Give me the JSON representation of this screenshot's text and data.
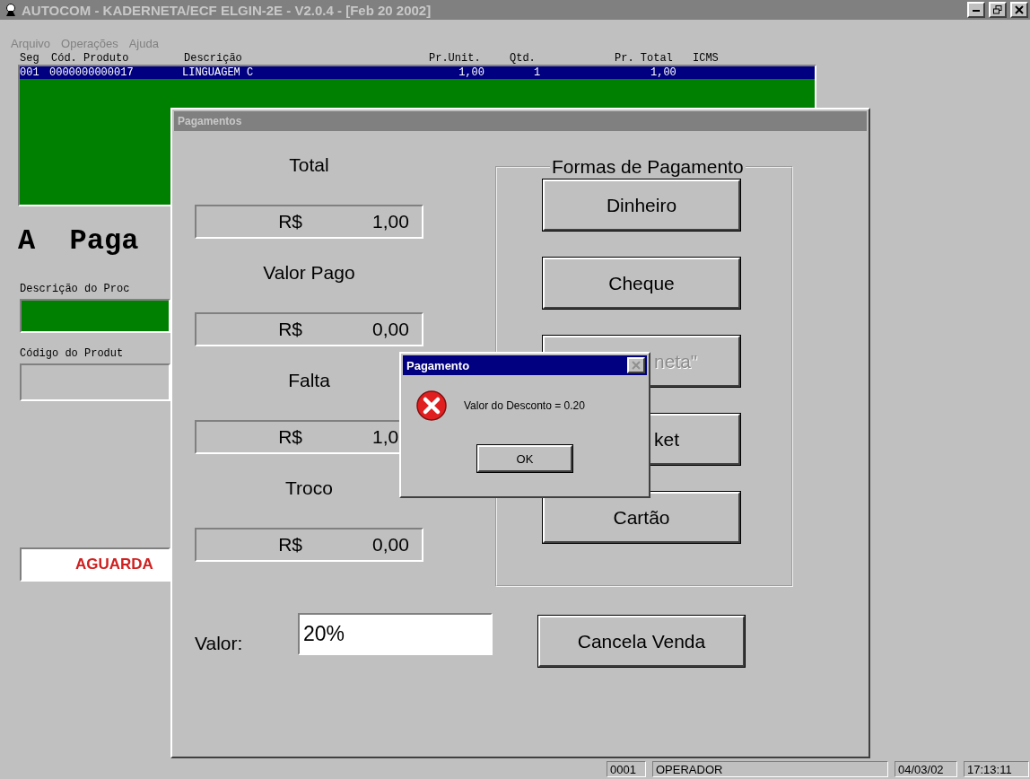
{
  "window": {
    "title": "AUTOCOM - KADERNETA/ECF ELGIN-2E - V2.0.4 - [Feb 20 2002]",
    "active": false
  },
  "menu": [
    "Arquivo",
    "Operações",
    "Ajuda"
  ],
  "table": {
    "columns": [
      "Seg",
      "Cód. Produto",
      "Descrição",
      "Pr.Unit.",
      "Qtd.",
      "Pr. Total",
      "ICMS"
    ],
    "rows": [
      {
        "cells": [
          "001",
          "0000000000017",
          "LINGUAGEM C",
          "1,00",
          "1",
          "1,00"
        ],
        "selected": true
      }
    ]
  },
  "heading": "A  Paga",
  "fields": [
    {
      "label": "Descrição do Proc",
      "kind": "green"
    },
    {
      "label": "Código do Produt",
      "kind": "plain"
    }
  ],
  "status_message": "AGUARDA",
  "status_bar": [
    "0001",
    "OPERADOR",
    "04/03/02",
    "17:13:11"
  ],
  "payments_dialog": {
    "title": "Pagamentos",
    "active": false,
    "summary": [
      {
        "label": "Total",
        "currency": "R$",
        "value": "1,00"
      },
      {
        "label": "Valor Pago",
        "currency": "R$",
        "value": "0,00"
      },
      {
        "label": "Falta",
        "currency": "R$",
        "value": "1,0"
      },
      {
        "label": "Troco",
        "currency": "R$",
        "value": "0,00"
      }
    ],
    "group": "Formas de Pagamento",
    "methods": [
      {
        "label": "Dinheiro",
        "disabled": false,
        "kind": "full"
      },
      {
        "label": "Cheque",
        "disabled": false,
        "kind": "full"
      },
      {
        "label": "neta\"",
        "disabled": true,
        "kind": "partial"
      },
      {
        "label": "ket",
        "disabled": false,
        "kind": "partial"
      },
      {
        "label": "Cartão",
        "disabled": false,
        "kind": "full"
      }
    ],
    "amount": {
      "label": "Valor:",
      "value": "20%"
    },
    "cancel": "Cancela Venda"
  },
  "message_box": {
    "title": "Pagamento",
    "active": true,
    "text": "Valor do Desconto = 0.20",
    "button": "OK"
  }
}
